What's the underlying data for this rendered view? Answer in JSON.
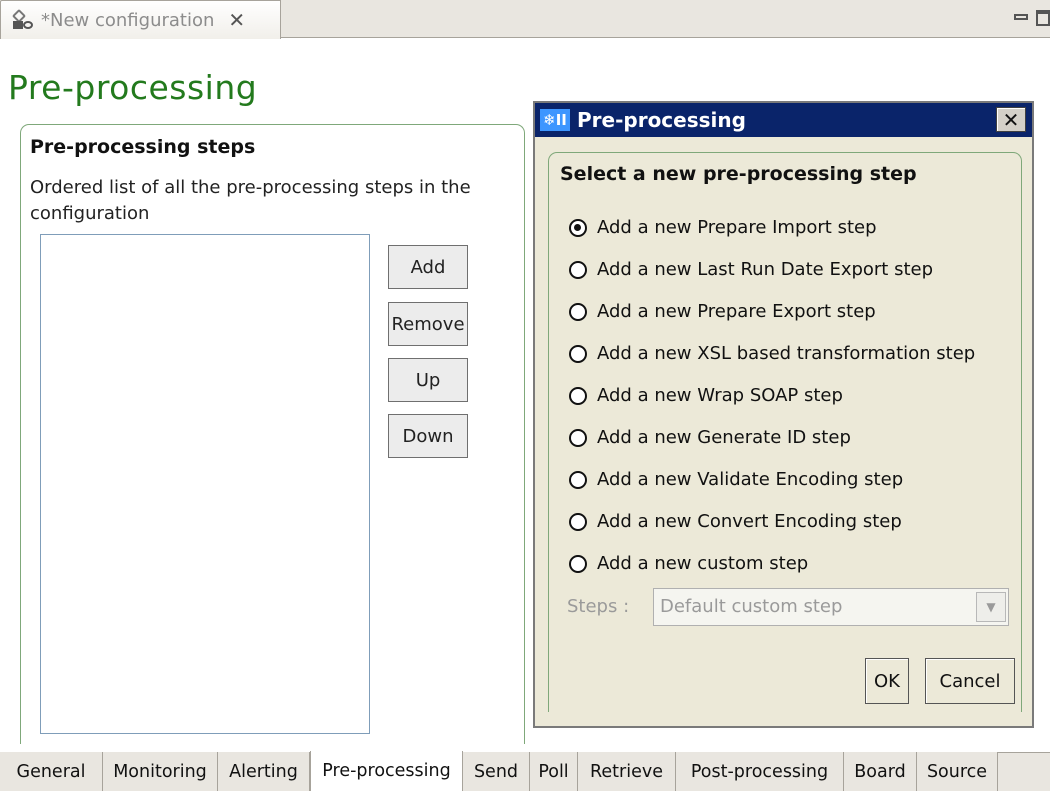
{
  "editor_tab": {
    "title": "*New configuration",
    "close_glyph": "✕"
  },
  "page": {
    "title": "Pre-processing"
  },
  "steps_section": {
    "title": "Pre-processing steps",
    "description": "Ordered list of all the pre-processing steps in the configuration",
    "buttons": {
      "add": "Add",
      "remove": "Remove",
      "up": "Up",
      "down": "Down"
    }
  },
  "bottom_tabs": [
    "General",
    "Monitoring",
    "Alerting",
    "Pre-processing",
    "Send",
    "Poll",
    "Retrieve",
    "Post-processing",
    "Board",
    "Source"
  ],
  "active_bottom_tab": "Pre-processing",
  "dialog": {
    "title": "Pre-processing",
    "icon_text": "❄II",
    "close_glyph": "✕",
    "group_title": "Select a new pre-processing step",
    "options": [
      {
        "label": "Add a new Prepare Import step",
        "checked": true
      },
      {
        "label": "Add a new Last Run Date Export step",
        "checked": false
      },
      {
        "label": "Add a new Prepare Export step",
        "checked": false
      },
      {
        "label": "Add a new XSL based transformation step",
        "checked": false
      },
      {
        "label": "Add a new Wrap SOAP step",
        "checked": false
      },
      {
        "label": "Add a new Generate ID step",
        "checked": false
      },
      {
        "label": "Add a new Validate Encoding step",
        "checked": false
      },
      {
        "label": "Add a new Convert Encoding step",
        "checked": false
      },
      {
        "label": "Add a new custom step",
        "checked": false
      }
    ],
    "steps_label": "Steps :",
    "steps_value": "Default custom step",
    "ok": "OK",
    "cancel": "Cancel"
  },
  "colors": {
    "title_green": "#237a1d",
    "dialog_titlebar": "#0a246a",
    "group_border": "#7fa87a"
  }
}
